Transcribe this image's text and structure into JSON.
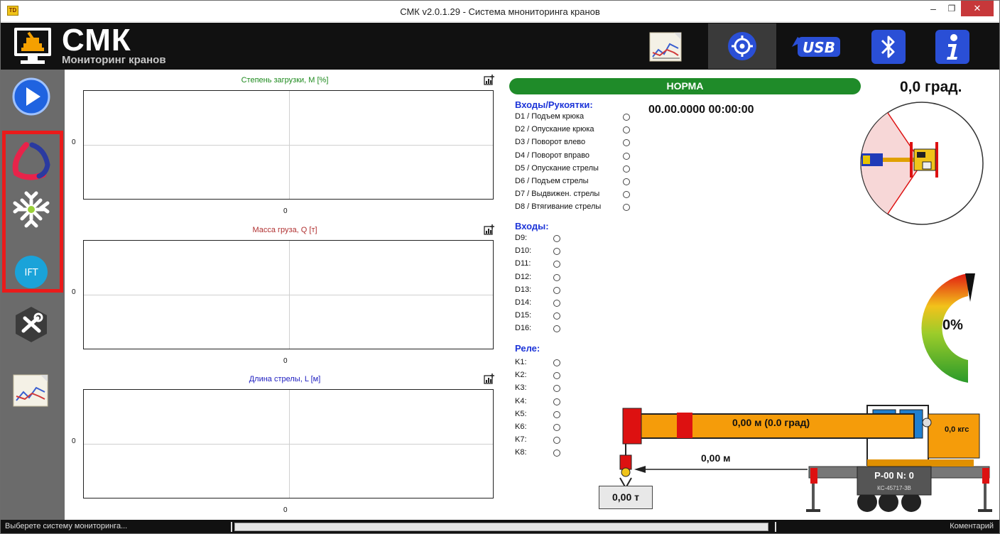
{
  "window": {
    "title": "СМК v2.0.1.29 - Система мнониторинга кранов",
    "app_icon_label": "TD",
    "minimize": "–",
    "maximize": "❐",
    "close": "✕"
  },
  "header": {
    "logo_title": "СМК",
    "logo_subtitle": "Мониторинг кранов",
    "buttons": [
      "chart-icon",
      "target-icon",
      "usb-icon",
      "bluetooth-icon",
      "info-icon"
    ],
    "usb_label": "USB"
  },
  "sidebar": {
    "items": [
      "play-icon",
      "red-blue-logo-icon",
      "snowflake-logo-icon",
      "ift-logo-icon",
      "tools-icon",
      "chart-icon"
    ],
    "ift_label": "IFT",
    "highlight_color": "#ea1b1b"
  },
  "charts": [
    {
      "title": "Степень загрузки, М [%]",
      "title_color": "#1d8a1d",
      "y_tick": "0",
      "x_tick": "0"
    },
    {
      "title": "Масса груза, Q [т]",
      "title_color": "#b03030",
      "y_tick": "0",
      "x_tick": "0"
    },
    {
      "title": "Длина стрелы, L [м]",
      "title_color": "#2020c0",
      "y_tick": "0",
      "x_tick": "0"
    }
  ],
  "status": {
    "label": "НОРМА",
    "color": "#1f8b29"
  },
  "datetime": "00.00.0000 00:00:00",
  "inputs_handles": {
    "heading": "Входы/Рукоятки:",
    "items": [
      "D1 / Подъем крюка",
      "D2 / Опускание крюка",
      "D3 / Поворот влево",
      "D4 / Поворот вправо",
      "D5 / Опускание стрелы",
      "D6 / Подъем стрелы",
      "D7 / Выдвижен. стрелы",
      "D8 / Втягивание стрелы"
    ]
  },
  "inputs": {
    "heading": "Входы:",
    "items": [
      "D9:",
      "D10:",
      "D11:",
      "D12:",
      "D13:",
      "D14:",
      "D15:",
      "D16:"
    ]
  },
  "relays": {
    "heading": "Реле:",
    "items": [
      "K1:",
      "K2:",
      "K3:",
      "K4:",
      "K5:",
      "K6:",
      "K7:",
      "K8:"
    ]
  },
  "rotation_angle": "0,0 град.",
  "load_percent": "0%",
  "load_percent_value": 0,
  "crane": {
    "boom": "0,00 м (0.0 град)",
    "reach": "0,00 м",
    "load": "0,00 т",
    "force": "0,0 кгс",
    "plate": "Р-00  N: 0",
    "model": "КС-45717-3В"
  },
  "statusbar": {
    "message": "Выберете систему мониторинга...",
    "progress_value": 0,
    "comment": "Коментарий"
  }
}
